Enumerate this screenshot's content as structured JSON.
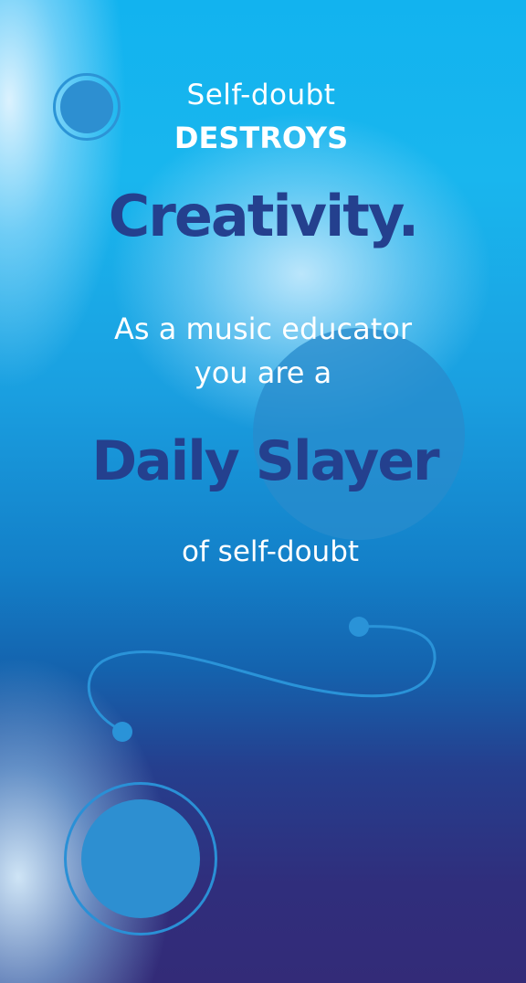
{
  "poster": {
    "line_1": "Self-doubt",
    "line_2": "DESTROYS",
    "line_3": "Creativity.",
    "line_4": "As a music educator",
    "line_5": "you are a",
    "line_6": "Daily Slayer",
    "line_7": "of self-doubt"
  },
  "colors": {
    "accent_dark_blue": "#24408e",
    "text_white": "#ffffff",
    "circle_blue": "#2d8fd1",
    "background_top": "#12b3ef",
    "background_bottom": "#332b78"
  },
  "decorations": [
    "ring-circle-top-left",
    "large-translucent-circle",
    "wavy-line-with-dots",
    "ring-circle-bottom-left"
  ]
}
